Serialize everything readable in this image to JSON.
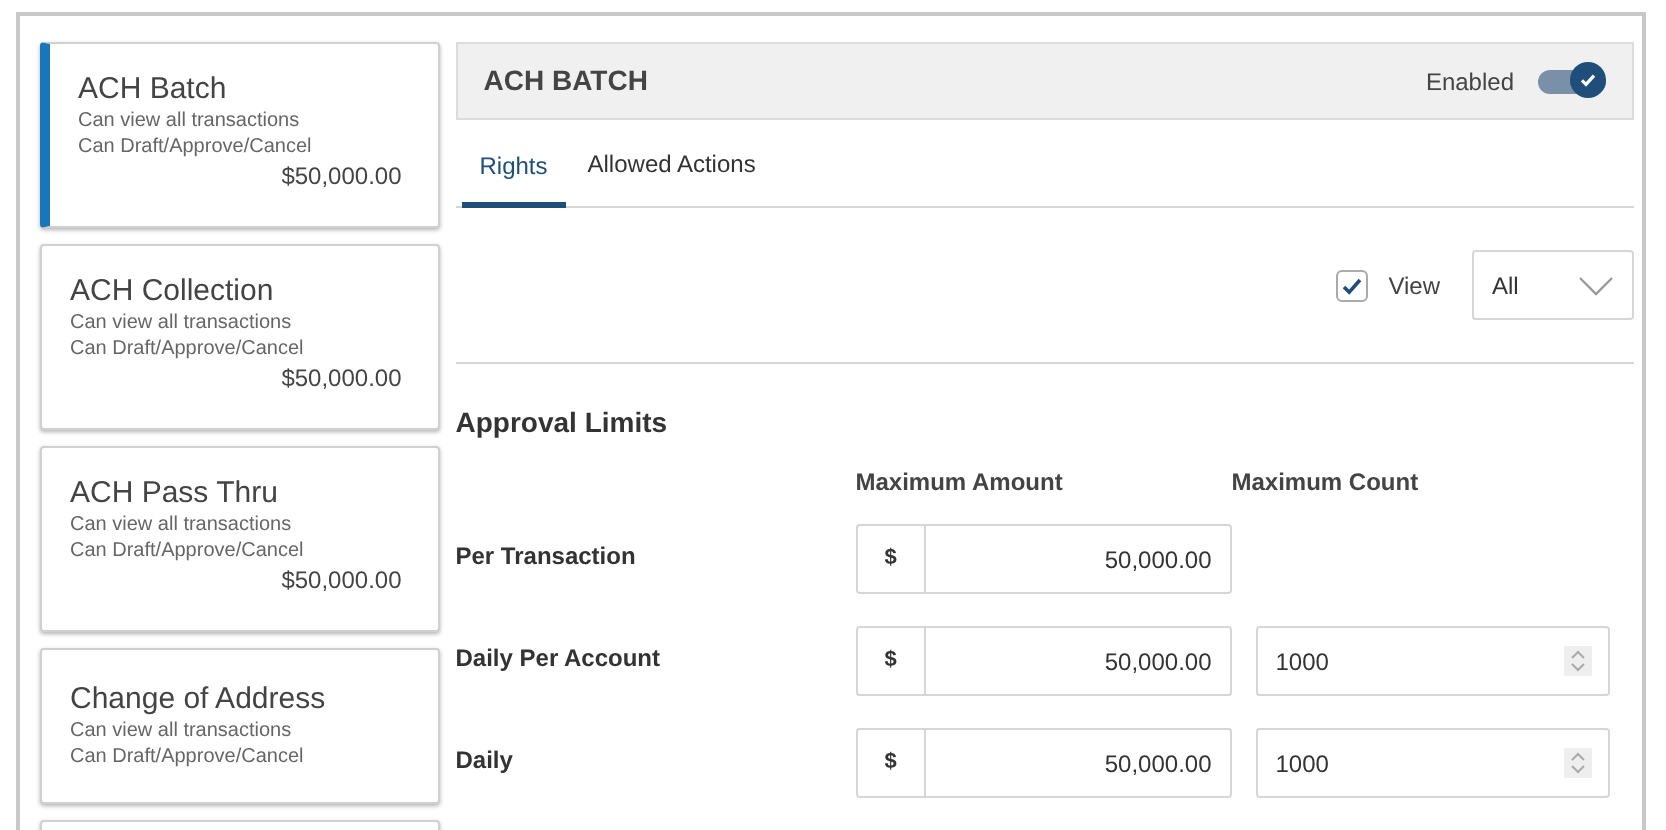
{
  "sidebar": {
    "items": [
      {
        "title": "ACH Batch",
        "lines": [
          "Can view all transactions",
          "Can Draft/Approve/Cancel"
        ],
        "amount": "$50,000.00",
        "selected": true
      },
      {
        "title": "ACH Collection",
        "lines": [
          "Can view all transactions",
          "Can Draft/Approve/Cancel"
        ],
        "amount": "$50,000.00",
        "selected": false
      },
      {
        "title": "ACH Pass Thru",
        "lines": [
          "Can view all transactions",
          "Can Draft/Approve/Cancel"
        ],
        "amount": "$50,000.00",
        "selected": false
      },
      {
        "title": "Change of Address",
        "lines": [
          "Can view all transactions",
          "Can Draft/Approve/Cancel"
        ],
        "selected": false
      },
      {
        "selected": false
      }
    ]
  },
  "header": {
    "title": "ACH BATCH",
    "toggle_label": "Enabled",
    "on": true
  },
  "tabs": [
    {
      "label": "Rights",
      "selected": true
    },
    {
      "label": "Allowed Actions",
      "selected": false
    }
  ],
  "rights": {
    "view_label": "View",
    "view_checked": true,
    "select_value": "All"
  },
  "approval_limits": {
    "title": "Approval Limits",
    "columns": [
      "Maximum Amount",
      "Maximum Count"
    ],
    "rows": [
      {
        "label": "Per Transaction",
        "currency": "$",
        "amount": "50,000.00"
      },
      {
        "label": "Daily Per Account",
        "currency": "$",
        "amount": "50,000.00",
        "count": "1000"
      },
      {
        "label": "Daily",
        "currency": "$",
        "amount": "50,000.00",
        "count": "1000"
      }
    ]
  }
}
